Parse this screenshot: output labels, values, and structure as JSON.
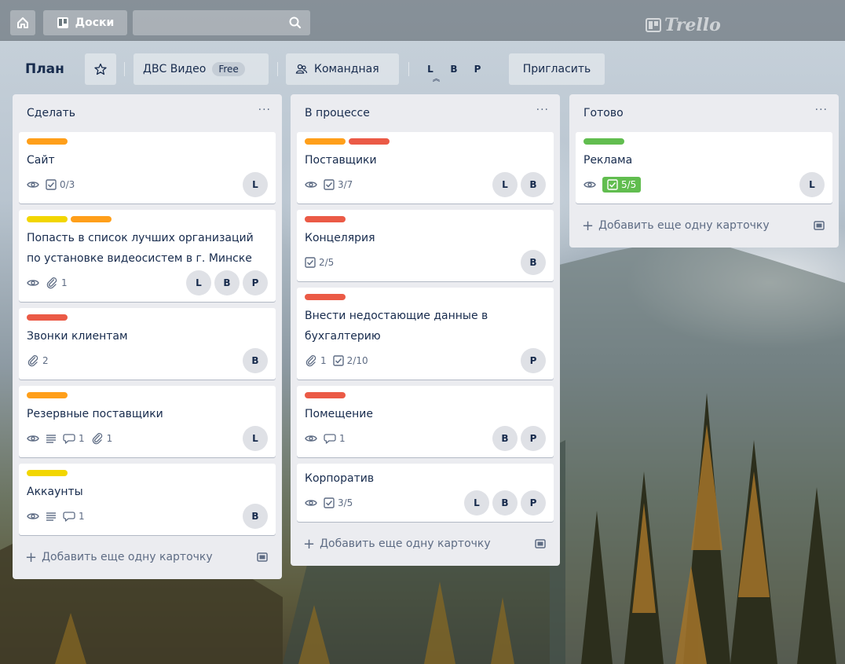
{
  "topbar": {
    "boards_label": "Доски",
    "logo_text": "Trello",
    "search_value": ""
  },
  "board": {
    "title": "План",
    "team_label": "ДВС Видео",
    "team_badge": "Free",
    "visibility_label": "Командная",
    "members": [
      "L",
      "B",
      "P"
    ],
    "invite_label": "Пригласить"
  },
  "lists": [
    {
      "title": "Сделать",
      "menu": "···",
      "add_label": "Добавить еще одну карточку",
      "cards": [
        {
          "labels": [
            "#ff9f1a"
          ],
          "title": "Сайт",
          "watch": true,
          "checklist": "0/3",
          "members": [
            "L"
          ]
        },
        {
          "labels": [
            "#f2d600",
            "#ff9f1a"
          ],
          "title": "Попасть в список лучших организаций по установке видеосистем в г. Минске",
          "watch": true,
          "attachments": "1",
          "members": [
            "L",
            "B",
            "P"
          ]
        },
        {
          "labels": [
            "#eb5a46"
          ],
          "title": "Звонки клиентам",
          "attachments": "2",
          "members": [
            "B"
          ]
        },
        {
          "labels": [
            "#ff9f1a"
          ],
          "title": "Резервные поставщики",
          "watch": true,
          "description": true,
          "comments": "1",
          "attachments": "1",
          "members": [
            "L"
          ]
        },
        {
          "labels": [
            "#f2d600"
          ],
          "title": "Аккаунты",
          "watch": true,
          "description": true,
          "comments": "1",
          "members": [
            "B"
          ]
        }
      ]
    },
    {
      "title": "В процессе",
      "menu": "···",
      "add_label": "Добавить еще одну карточку",
      "cards": [
        {
          "labels": [
            "#ff9f1a",
            "#eb5a46"
          ],
          "title": "Поставщики",
          "watch": true,
          "checklist": "3/7",
          "members": [
            "L",
            "B"
          ]
        },
        {
          "labels": [
            "#eb5a46"
          ],
          "title": "Концелярия",
          "checklist": "2/5",
          "members": [
            "B"
          ]
        },
        {
          "labels": [
            "#eb5a46"
          ],
          "title": "Внести недостающие данные в бухгалтерию",
          "attachments": "1",
          "checklist": "2/10",
          "members": [
            "P"
          ]
        },
        {
          "labels": [
            "#eb5a46"
          ],
          "title": "Помещение",
          "watch": true,
          "comments": "1",
          "members": [
            "B",
            "P"
          ]
        },
        {
          "labels": [],
          "title": "Корпоратив",
          "watch": true,
          "checklist": "3/5",
          "members": [
            "L",
            "B",
            "P"
          ]
        }
      ]
    },
    {
      "title": "Готово",
      "menu": "···",
      "add_label": "Добавить еще одну карточку",
      "cards": [
        {
          "labels": [
            "#61bd4f"
          ],
          "title": "Реклама",
          "watch": true,
          "checklist": "5/5",
          "checklist_complete": true,
          "members": [
            "L"
          ]
        }
      ]
    }
  ],
  "colors": {
    "list_bg": "#ebecf0",
    "complete_green": "#61bd4f"
  }
}
